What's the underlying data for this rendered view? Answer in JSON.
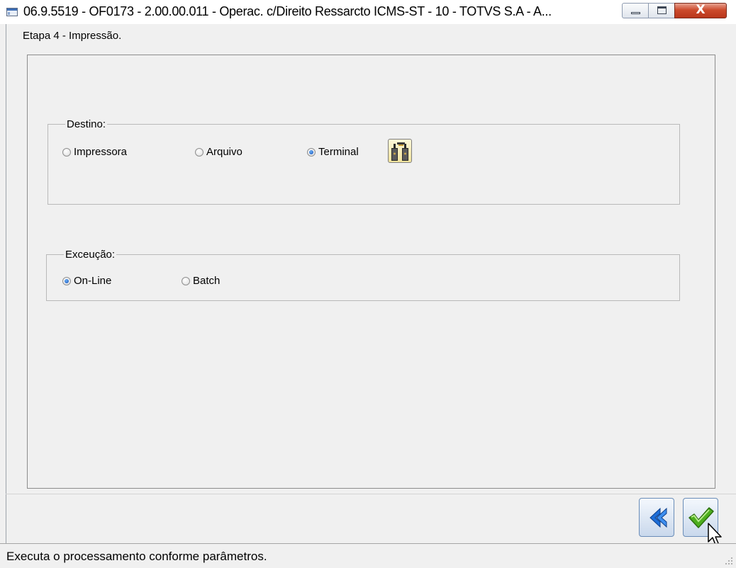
{
  "window": {
    "title": "06.9.5519 - OF0173 - 2.00.00.011 - Operac. c/Direito Ressarcto ICMS-ST - 10 - TOTVS S.A - A...",
    "controls": [
      "minimize-icon",
      "maximize-icon",
      "close-icon"
    ],
    "close_glyph": "X"
  },
  "step": {
    "label": "Etapa 4 - Impressão."
  },
  "destino": {
    "legend": "Destino:",
    "options": [
      {
        "label": "Impressora",
        "selected": false
      },
      {
        "label": "Arquivo",
        "selected": false
      },
      {
        "label": "Terminal",
        "selected": true
      }
    ],
    "settings_icon": "printer-settings-icon"
  },
  "execucao": {
    "legend": "Exceução:",
    "options": [
      {
        "label": "On-Line",
        "selected": true
      },
      {
        "label": "Batch",
        "selected": false
      }
    ]
  },
  "navigation": {
    "back_icon": "double-chevron-left-icon",
    "confirm_icon": "checkmark-icon"
  },
  "status": {
    "text": "Executa o processamento conforme parâmetros."
  },
  "colors": {
    "radio_selected": "#1650b8",
    "checkmark": "#4cae1e",
    "back_arrow": "#1e6fd9",
    "close_button": "#cc4b2d"
  }
}
